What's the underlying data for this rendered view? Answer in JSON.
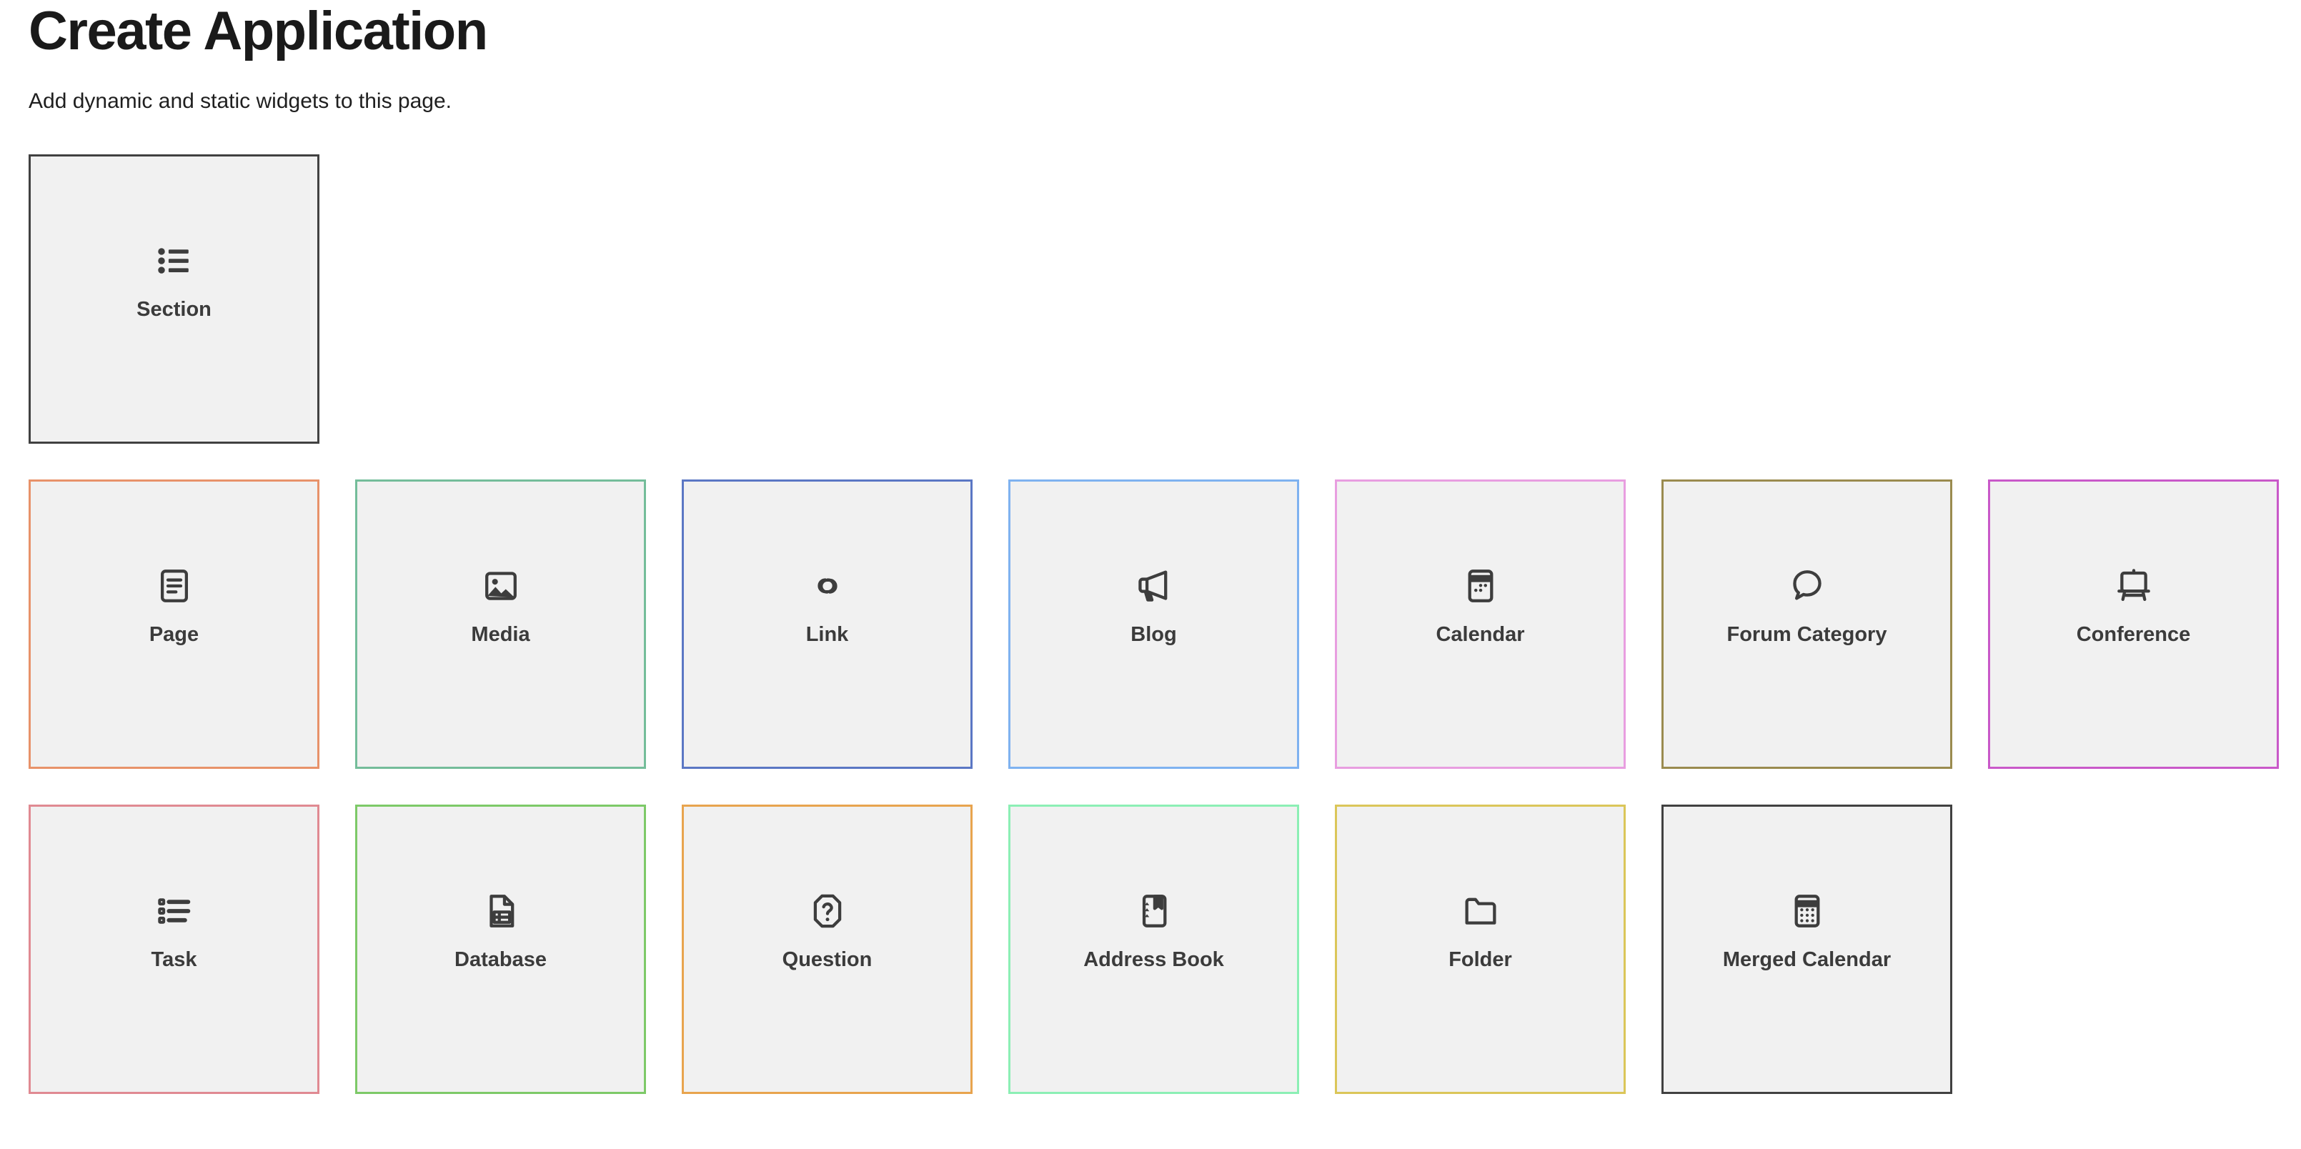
{
  "header": {
    "title": "Create Application",
    "subtitle": "Add dynamic and static widgets to this page."
  },
  "section_row": [
    {
      "label": "Section",
      "icon": "bulleted-list-icon",
      "border_color": "#414141"
    }
  ],
  "primary_row": [
    {
      "label": "Page",
      "icon": "document-lines-icon",
      "border_color": "#e8926a"
    },
    {
      "label": "Media",
      "icon": "image-icon",
      "border_color": "#74bd9a"
    },
    {
      "label": "Link",
      "icon": "chain-link-icon",
      "border_color": "#5b77c4"
    },
    {
      "label": "Blog",
      "icon": "megaphone-icon",
      "border_color": "#7fb2f0"
    },
    {
      "label": "Calendar",
      "icon": "calendar-icon",
      "border_color": "#e89ee0"
    },
    {
      "label": "Forum Category",
      "icon": "speech-bubble-icon",
      "border_color": "#9a8b4f"
    },
    {
      "label": "Conference",
      "icon": "presentation-easel-icon",
      "border_color": "#c959c9"
    }
  ],
  "secondary_row": [
    {
      "label": "Task",
      "icon": "checklist-icon",
      "border_color": "#e08a92"
    },
    {
      "label": "Database",
      "icon": "document-table-icon",
      "border_color": "#7dc968"
    },
    {
      "label": "Question",
      "icon": "question-octagon-icon",
      "border_color": "#e8a44e"
    },
    {
      "label": "Address Book",
      "icon": "bookmark-book-icon",
      "border_color": "#8cefb5"
    },
    {
      "label": "Folder",
      "icon": "folder-icon",
      "border_color": "#dbc659"
    },
    {
      "label": "Merged Calendar",
      "icon": "calendar-dots-icon",
      "border_color": "#414141"
    }
  ]
}
